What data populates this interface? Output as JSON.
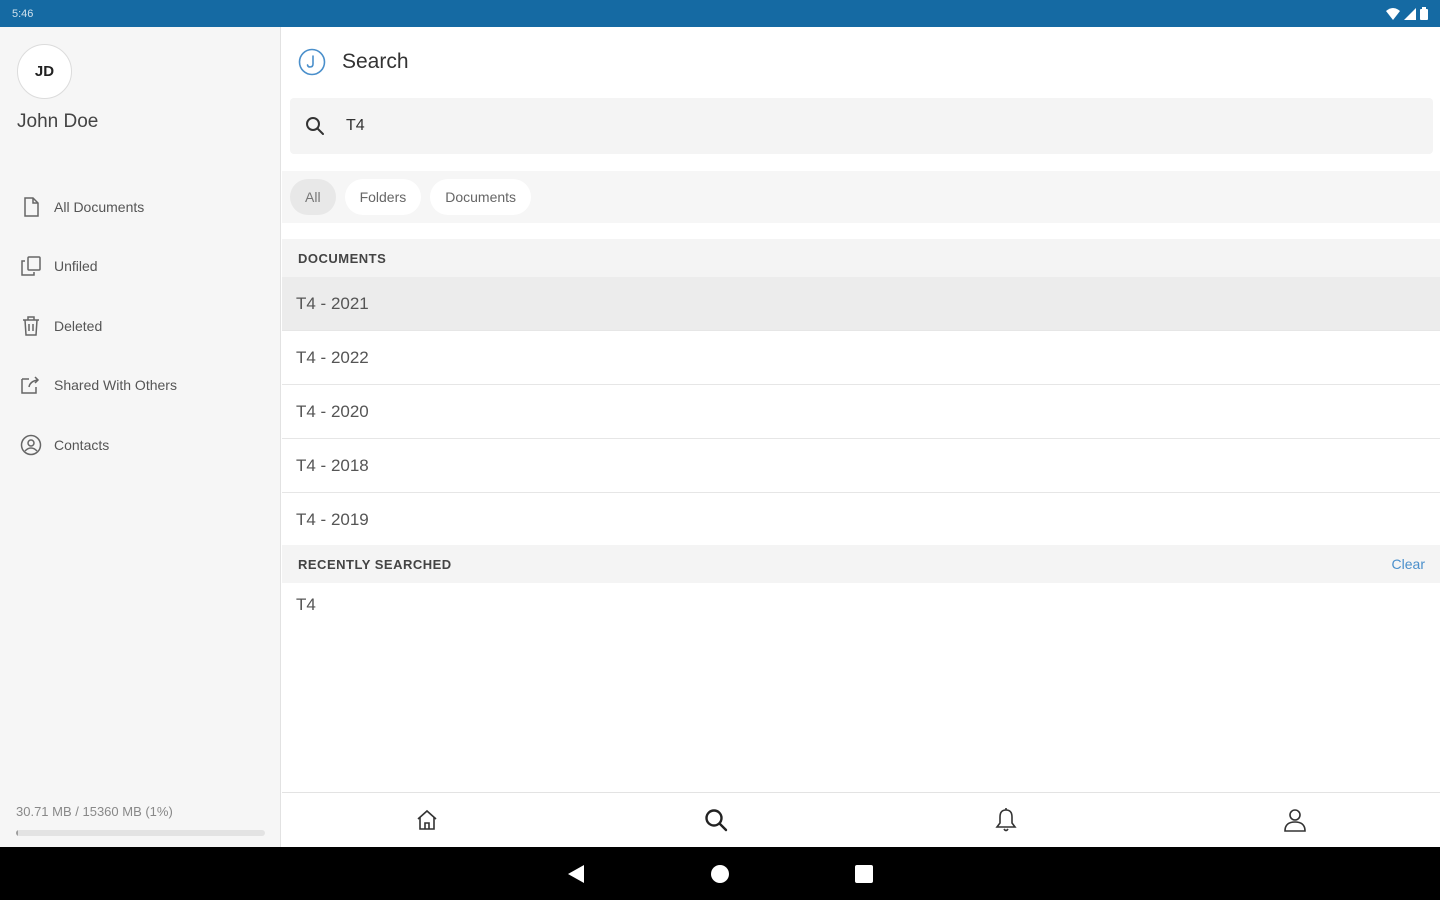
{
  "status_bar": {
    "time": "5:46"
  },
  "sidebar": {
    "avatar_initials": "JD",
    "user_name": "John Doe",
    "items": [
      {
        "label": "All Documents",
        "icon": "document-icon"
      },
      {
        "label": "Unfiled",
        "icon": "copy-icon"
      },
      {
        "label": "Deleted",
        "icon": "trash-icon"
      },
      {
        "label": "Shared With Others",
        "icon": "share-icon"
      },
      {
        "label": "Contacts",
        "icon": "contact-icon"
      }
    ],
    "storage_text": "30.71 MB / 15360 MB (1%)",
    "storage_percent": 1
  },
  "header": {
    "title": "Search"
  },
  "search": {
    "value": "T4"
  },
  "filters": [
    {
      "label": "All",
      "selected": true
    },
    {
      "label": "Folders",
      "selected": false
    },
    {
      "label": "Documents",
      "selected": false
    }
  ],
  "documents_section": {
    "title": "DOCUMENTS",
    "items": [
      "T4 - 2021",
      "T4 - 2022",
      "T4 - 2020",
      "T4 - 2018",
      "T4 - 2019"
    ]
  },
  "recent_section": {
    "title": "RECENTLY SEARCHED",
    "action": "Clear",
    "items": [
      "T4"
    ]
  },
  "bottom_nav": [
    "home-icon",
    "search-icon",
    "bell-icon",
    "person-icon"
  ],
  "colors": {
    "status_bar": "#156aa3",
    "accent": "#4a8fcb"
  }
}
